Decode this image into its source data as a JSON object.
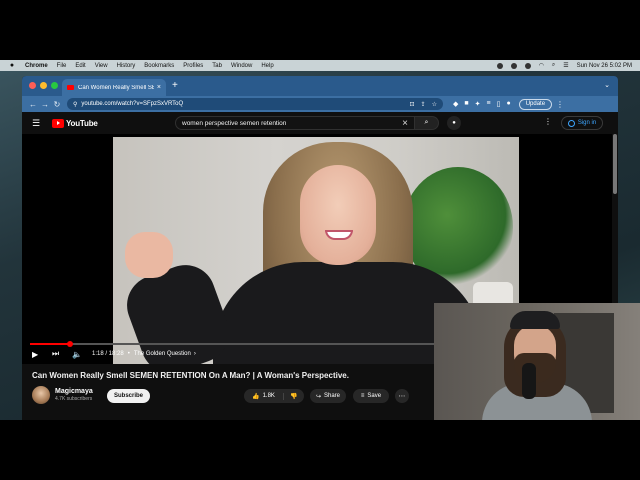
{
  "menubar": {
    "apple": "",
    "items": [
      "Chrome",
      "File",
      "Edit",
      "View",
      "History",
      "Bookmarks",
      "Profiles",
      "Tab",
      "Window",
      "Help"
    ],
    "clock": "Sun Nov 26  5:02 PM"
  },
  "browser": {
    "tab_title": "Can Women Really Smell SEM",
    "tab_close": "×",
    "new_tab": "+",
    "url": "youtube.com/watch?v=SFpzSxVRToQ",
    "update_label": "Update"
  },
  "youtube": {
    "logo_text": "YouTube",
    "search_query": "women perspective semen retention",
    "sign_in": "Sign in"
  },
  "player": {
    "progress": 0.07,
    "time": "1:18 / 18:28",
    "separator": "•",
    "chapter": "The Golden Question",
    "chapter_arrow": "›"
  },
  "video": {
    "title": "Can Women Really Smell SEMEN RETENTION On A Man? | A Woman's Perspective.",
    "channel_name": "Magicmaya",
    "subscribers": "4.7K subscribers",
    "subscribe_label": "Subscribe",
    "likes": "1.8K",
    "share_label": "Share",
    "save_label": "Save"
  },
  "colors": {
    "yt_red": "#ff0000",
    "browser_chrome": "#3c6fa3",
    "yt_bg": "#0f0f0f"
  }
}
